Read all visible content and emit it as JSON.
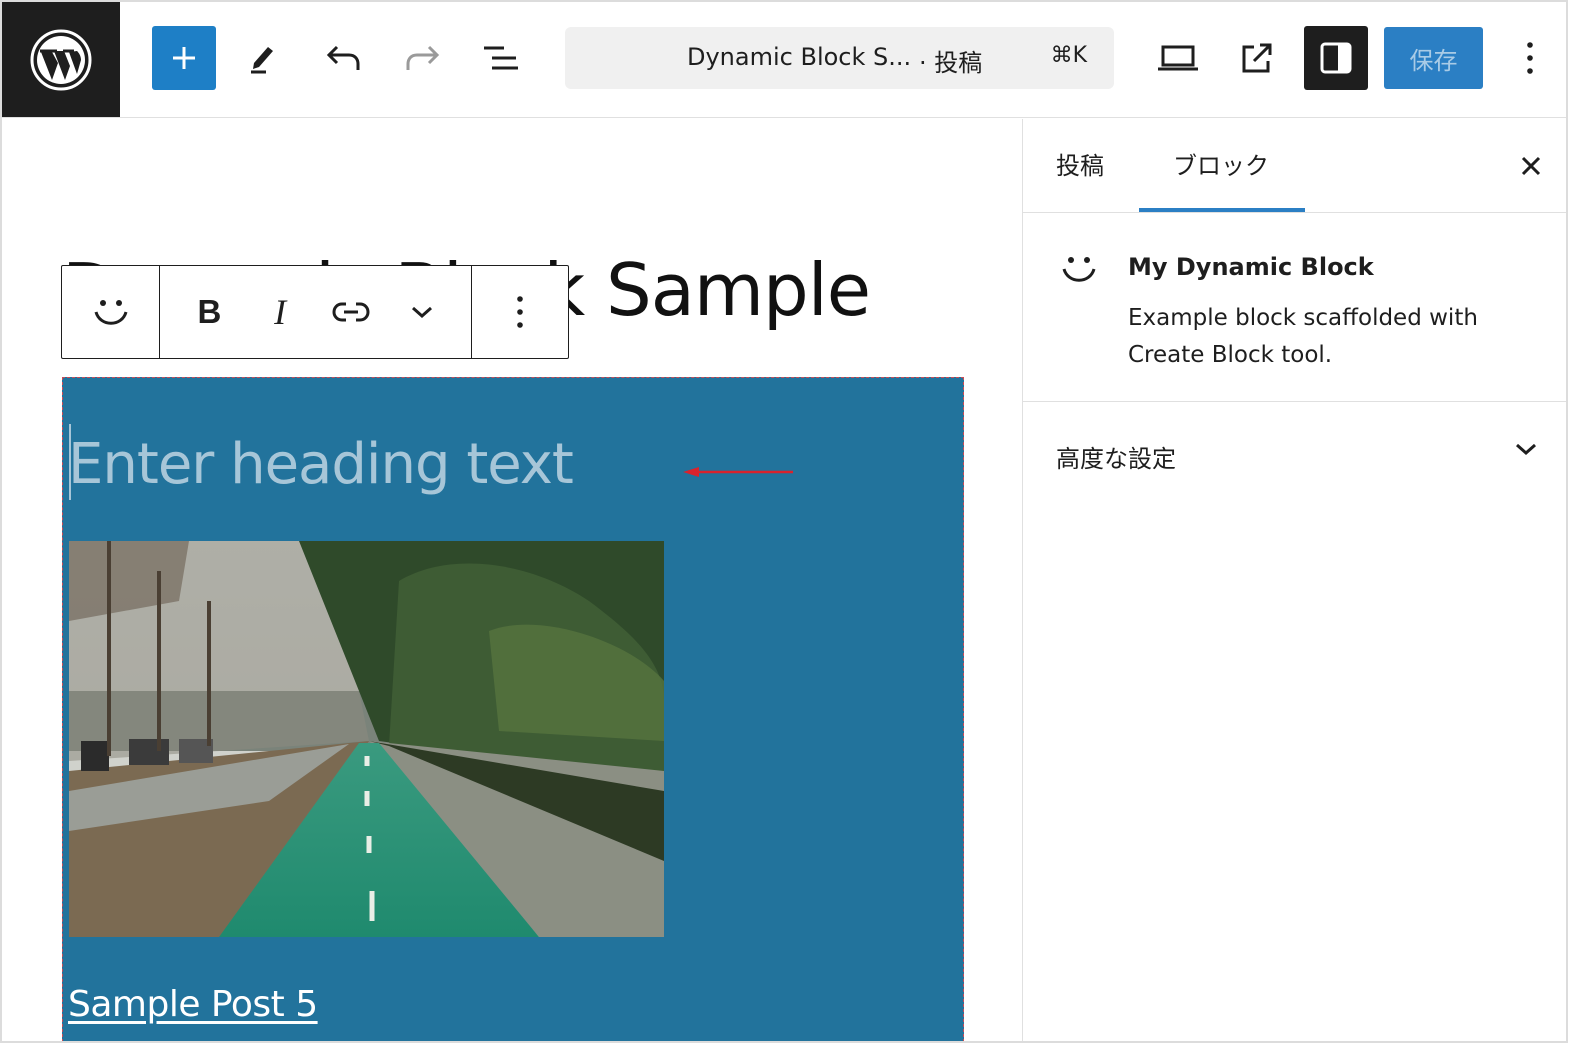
{
  "header": {
    "add_icon": "plus-icon",
    "tools_icon": "pencil-icon",
    "undo_icon": "undo-icon",
    "redo_icon": "redo-icon",
    "list_view_icon": "list-view-icon",
    "command_bar": {
      "title": "Dynamic Block S...",
      "post_type": "· 投稿",
      "shortcut": "⌘K"
    },
    "preview_icon": "desktop-icon",
    "view_post_icon": "external-link-icon",
    "settings_icon": "sidebar-icon",
    "save_label": "保存",
    "more_icon": "more-vertical-icon"
  },
  "editor": {
    "post_title": "Dynamic Block Sample",
    "block_toolbar": {
      "block_icon": "smiley-icon",
      "bold_label": "B",
      "italic_label": "I",
      "link_icon": "link-icon",
      "more_icon": "chevron-down-icon",
      "options_icon": "more-vertical-icon"
    },
    "dynamic_block": {
      "heading_placeholder": "Enter heading text",
      "image_alt": "Tree-lined green bike path",
      "post_link": "Sample Post 5"
    }
  },
  "sidebar": {
    "tabs": [
      {
        "label": "投稿",
        "active": false
      },
      {
        "label": "ブロック",
        "active": true
      }
    ],
    "block": {
      "name": "My Dynamic Block",
      "description": "Example block scaffolded with Create Block tool."
    },
    "advanced": {
      "label": "高度な設定"
    }
  },
  "colors": {
    "accent": "#2b7fc4",
    "block_background": "#22739c",
    "dark": "#1e1e1e",
    "annotation_arrow": "#d9232d"
  }
}
